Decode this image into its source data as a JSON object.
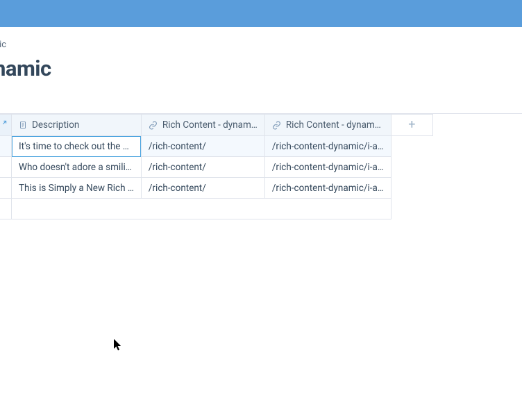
{
  "breadcrumb": "dynamic",
  "page_title": " - dynamic",
  "table": {
    "columns": {
      "description": "Description",
      "rich1": "Rich Content - dynam…",
      "rich2": "Rich Content - dynam…",
      "add": "+"
    },
    "rows": [
      {
        "description": "It's time to check out the …",
        "rich1": "/rich-content/",
        "rich2": "/rich-content-dynamic/i-a…"
      },
      {
        "description": "Who doesn't adore a smili…",
        "rich1": "/rich-content/",
        "rich2": "/rich-content-dynamic/i-a…"
      },
      {
        "description": "This is Simply a New Rich …",
        "rich1": "/rich-content/",
        "rich2": "/rich-content-dynamic/i-a…"
      }
    ]
  }
}
